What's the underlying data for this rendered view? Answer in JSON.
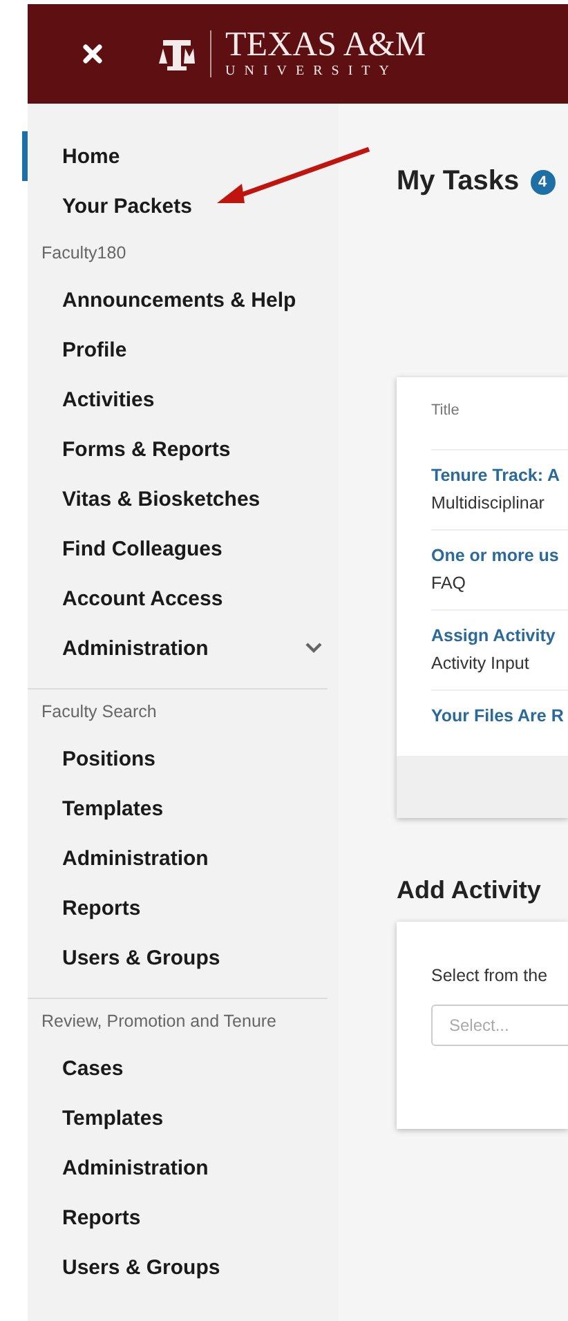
{
  "header": {
    "title": "TEXAS A&M",
    "subtitle": "UNIVERSITY"
  },
  "sidebar": {
    "sections": [
      {
        "items": [
          {
            "label": "Home",
            "selected": true
          },
          {
            "label": "Your Packets",
            "selected": false
          }
        ]
      },
      {
        "label": "Faculty180",
        "items": [
          {
            "label": "Announcements & Help",
            "selected": false
          },
          {
            "label": "Profile",
            "selected": false
          },
          {
            "label": "Activities",
            "selected": false
          },
          {
            "label": "Forms & Reports",
            "selected": false
          },
          {
            "label": "Vitas & Biosketches",
            "selected": false
          },
          {
            "label": "Find Colleagues",
            "selected": false
          },
          {
            "label": "Account Access",
            "selected": false
          },
          {
            "label": "Administration",
            "selected": false,
            "expanded": false
          }
        ]
      },
      {
        "label": "Faculty Search",
        "items": [
          {
            "label": "Positions",
            "selected": false
          },
          {
            "label": "Templates",
            "selected": false
          },
          {
            "label": "Administration",
            "selected": false
          },
          {
            "label": "Reports",
            "selected": false
          },
          {
            "label": "Users & Groups",
            "selected": false
          }
        ]
      },
      {
        "label": "Review, Promotion and Tenure",
        "items": [
          {
            "label": "Cases",
            "selected": false
          },
          {
            "label": "Templates",
            "selected": false
          },
          {
            "label": "Administration",
            "selected": false
          },
          {
            "label": "Reports",
            "selected": false
          },
          {
            "label": "Users & Groups",
            "selected": false
          }
        ]
      }
    ]
  },
  "tasks": {
    "title": "My Tasks",
    "badge": "4",
    "column": "Title",
    "rows": [
      {
        "title": "Tenure Track: A",
        "subtitle": "Multidisciplinar"
      },
      {
        "title": "One or more us",
        "subtitle": "FAQ"
      },
      {
        "title": "Assign Activity",
        "subtitle": "Activity Input"
      },
      {
        "title": "Your Files Are R"
      }
    ]
  },
  "add_activity": {
    "title": "Add Activity",
    "prompt": "Select from the",
    "placeholder": "Select..."
  }
}
